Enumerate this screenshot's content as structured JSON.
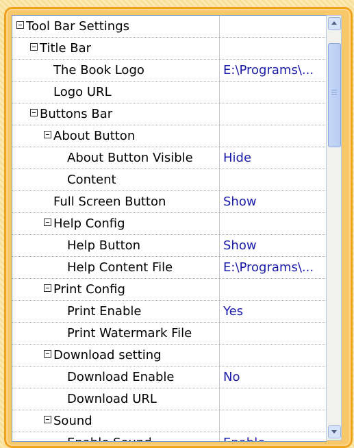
{
  "rows": [
    {
      "label": "Tool Bar Settings",
      "value": "",
      "level": 0,
      "expandable": true
    },
    {
      "label": "Title Bar",
      "value": "",
      "level": 1,
      "expandable": true
    },
    {
      "label": "The Book Logo",
      "value": "E:\\Programs\\...",
      "level": 2,
      "expandable": false
    },
    {
      "label": "Logo URL",
      "value": "",
      "level": 2,
      "expandable": false
    },
    {
      "label": "Buttons Bar",
      "value": "",
      "level": 1,
      "expandable": true
    },
    {
      "label": "About Button",
      "value": "",
      "level": 2,
      "expandable": true
    },
    {
      "label": "About Button Visible",
      "value": "Hide",
      "level": 3,
      "expandable": false
    },
    {
      "label": "Content",
      "value": "",
      "level": 3,
      "expandable": false
    },
    {
      "label": "Full Screen Button",
      "value": "Show",
      "level": 2,
      "expandable": false
    },
    {
      "label": "Help Config",
      "value": "",
      "level": 2,
      "expandable": true
    },
    {
      "label": "Help Button",
      "value": "Show",
      "level": 3,
      "expandable": false
    },
    {
      "label": "Help Content File",
      "value": "E:\\Programs\\...",
      "level": 3,
      "expandable": false
    },
    {
      "label": "Print Config",
      "value": "",
      "level": 2,
      "expandable": true
    },
    {
      "label": "Print Enable",
      "value": "Yes",
      "level": 3,
      "expandable": false
    },
    {
      "label": "Print Watermark File",
      "value": "",
      "level": 3,
      "expandable": false
    },
    {
      "label": "Download setting",
      "value": "",
      "level": 2,
      "expandable": true
    },
    {
      "label": "Download Enable",
      "value": "No",
      "level": 3,
      "expandable": false
    },
    {
      "label": "Download URL",
      "value": "",
      "level": 3,
      "expandable": false
    },
    {
      "label": "Sound",
      "value": "",
      "level": 2,
      "expandable": true
    },
    {
      "label": "Enable Sound",
      "value": "Enable",
      "level": 3,
      "expandable": false
    }
  ],
  "colors": {
    "frame_border": "#f0a21c",
    "value_text": "#1a1aa8",
    "grid_line": "#a8a8a8"
  },
  "icons": {
    "collapse": "minus-box-icon",
    "scroll_up": "arrow-up-icon",
    "scroll_down": "arrow-down-icon"
  }
}
